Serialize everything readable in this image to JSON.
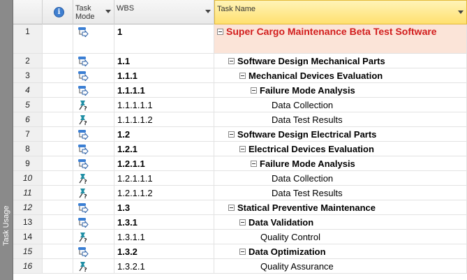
{
  "sidebar": {
    "label": "Task Usage"
  },
  "header": {
    "info_icon": "info-icon",
    "task_mode": "Task Mode",
    "wbs": "WBS",
    "task_name": "Task Name"
  },
  "rows": [
    {
      "id": "1",
      "italic": false,
      "mode": "auto",
      "wbs": "1",
      "name": "Super Cargo Maintenance Beta Test Software",
      "level": 0,
      "summary": true
    },
    {
      "id": "2",
      "italic": false,
      "mode": "auto",
      "wbs": "1.1",
      "name": "Software Design Mechanical Parts",
      "level": 1,
      "summary": true
    },
    {
      "id": "3",
      "italic": false,
      "mode": "auto",
      "wbs": "1.1.1",
      "name": "Mechanical Devices Evaluation",
      "level": 2,
      "summary": true
    },
    {
      "id": "4",
      "italic": true,
      "mode": "auto",
      "wbs": "1.1.1.1",
      "name": "Failure Mode Analysis",
      "level": 3,
      "summary": true
    },
    {
      "id": "5",
      "italic": true,
      "mode": "manual",
      "wbs": "1.1.1.1.1",
      "name": "Data Collection",
      "level": 4,
      "summary": false
    },
    {
      "id": "6",
      "italic": true,
      "mode": "manual",
      "wbs": "1.1.1.1.2",
      "name": "Data Test Results",
      "level": 4,
      "summary": false
    },
    {
      "id": "7",
      "italic": false,
      "mode": "auto",
      "wbs": "1.2",
      "name": "Software Design Electrical Parts",
      "level": 1,
      "summary": true
    },
    {
      "id": "8",
      "italic": false,
      "mode": "auto",
      "wbs": "1.2.1",
      "name": "Electrical Devices Evaluation",
      "level": 2,
      "summary": true
    },
    {
      "id": "9",
      "italic": false,
      "mode": "auto",
      "wbs": "1.2.1.1",
      "name": "Failure Mode Analysis",
      "level": 3,
      "summary": true
    },
    {
      "id": "10",
      "italic": true,
      "mode": "manual",
      "wbs": "1.2.1.1.1",
      "name": "Data Collection",
      "level": 4,
      "summary": false
    },
    {
      "id": "11",
      "italic": true,
      "mode": "manual",
      "wbs": "1.2.1.1.2",
      "name": "Data Test Results",
      "level": 4,
      "summary": false
    },
    {
      "id": "12",
      "italic": true,
      "mode": "auto",
      "wbs": "1.3",
      "name": "Statical Preventive Maintenance",
      "level": 1,
      "summary": true
    },
    {
      "id": "13",
      "italic": false,
      "mode": "auto",
      "wbs": "1.3.1",
      "name": "Data Validation",
      "level": 2,
      "summary": true
    },
    {
      "id": "14",
      "italic": false,
      "mode": "manual",
      "wbs": "1.3.1.1",
      "name": "Quality Control",
      "level": 3,
      "summary": false
    },
    {
      "id": "15",
      "italic": true,
      "mode": "auto",
      "wbs": "1.3.2",
      "name": "Data Optimization",
      "level": 2,
      "summary": true
    },
    {
      "id": "16",
      "italic": true,
      "mode": "manual",
      "wbs": "1.3.2.1",
      "name": "Quality Assurance",
      "level": 3,
      "summary": false
    }
  ],
  "colors": {
    "title_text": "#d21d1d",
    "title_row_bg": "#fbe4d8",
    "header_active": "#ffe06f",
    "auto_icon": "#3b7fd4",
    "manual_icon": "#1f8fa5"
  }
}
